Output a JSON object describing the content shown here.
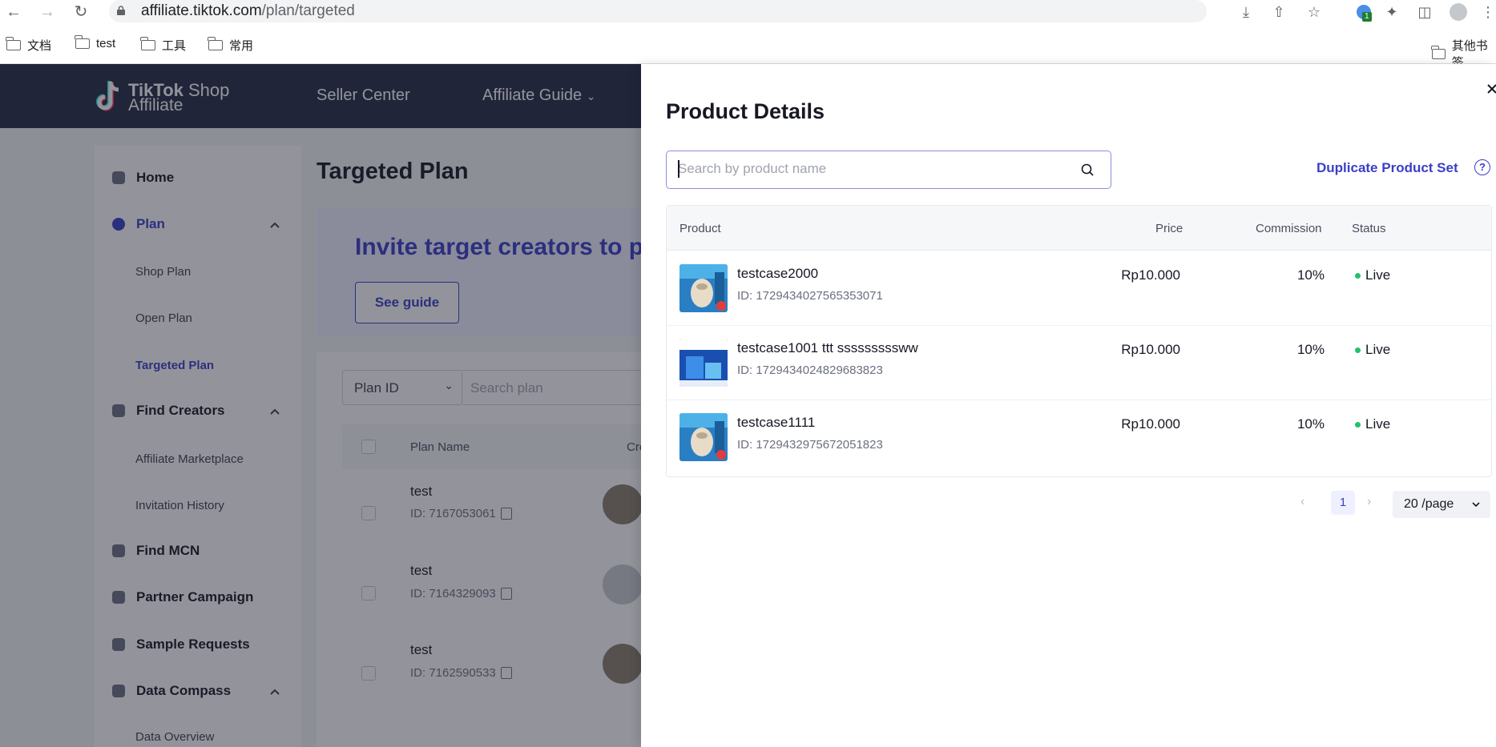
{
  "browser": {
    "url_host": "affiliate.tiktok.com",
    "url_path": "/plan/targeted",
    "bookmarks": [
      "文档",
      "test",
      "工具",
      "常用"
    ],
    "other_bookmarks": "其他书签",
    "extension_badge": "1"
  },
  "header": {
    "logo_line1_bold": "TikTok",
    "logo_line1_light": "Shop",
    "logo_line2": "Affiliate",
    "links": [
      "Seller Center",
      "Affiliate Guide"
    ]
  },
  "sidebar": {
    "home": "Home",
    "plan": "Plan",
    "plan_sub": [
      "Shop Plan",
      "Open Plan",
      "Targeted Plan"
    ],
    "find_creators": "Find Creators",
    "creators_sub": [
      "Affiliate Marketplace",
      "Invitation History"
    ],
    "find_mcn": "Find MCN",
    "partner_campaign": "Partner Campaign",
    "sample_requests": "Sample Requests",
    "data_compass": "Data Compass",
    "data_sub": [
      "Data Overview"
    ]
  },
  "main": {
    "title": "Targeted Plan",
    "banner_text": "Invite target creators to p",
    "guide_button": "See guide",
    "filter_select": "Plan ID",
    "filter_placeholder": "Search plan",
    "columns": [
      "Plan Name",
      "Creato"
    ],
    "rows": [
      {
        "name": "test",
        "id": "ID: 7167053061"
      },
      {
        "name": "test",
        "id": "ID: 7164329093"
      },
      {
        "name": "test",
        "id": "ID: 7162590533"
      }
    ]
  },
  "drawer": {
    "title": "Product Details",
    "search_placeholder": "Search by product name",
    "duplicate_link": "Duplicate Product Set",
    "columns": {
      "product": "Product",
      "price": "Price",
      "commission": "Commission",
      "status": "Status"
    },
    "products": [
      {
        "name": "testcase2000",
        "id": "ID: 1729434027565353071",
        "price": "Rp10.000",
        "commission": "10%",
        "status": "Live"
      },
      {
        "name": "testcase1001 ttt sssssssssww",
        "id": "ID: 1729434024829683823",
        "price": "Rp10.000",
        "commission": "10%",
        "status": "Live"
      },
      {
        "name": "testcase1111",
        "id": "ID: 1729432975672051823",
        "price": "Rp10.000",
        "commission": "10%",
        "status": "Live"
      }
    ],
    "pagination": {
      "current_page": "1",
      "page_size": "20 /page"
    }
  },
  "colors": {
    "brand": "#3a3fc7",
    "header_bg": "#252b46",
    "live": "#23c16b"
  }
}
